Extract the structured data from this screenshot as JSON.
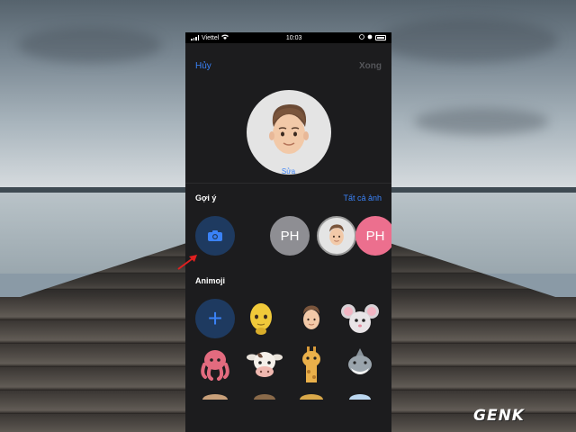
{
  "status_bar": {
    "carrier": "Viettel",
    "time": "10:03"
  },
  "nav": {
    "cancel_label": "Hủy",
    "done_label": "Xong"
  },
  "profile": {
    "edit_label": "Sửa"
  },
  "suggestions": {
    "title": "Gợi ý",
    "see_all_label": "Tất cả ảnh",
    "items": [
      {
        "type": "camera",
        "icon": "camera-icon"
      },
      {
        "type": "initials",
        "text": "PH",
        "color": "#8e8e93"
      },
      {
        "type": "memoji",
        "icon": "memoji-face"
      },
      {
        "type": "initials",
        "text": "PH",
        "color": "#ec6f8e"
      }
    ]
  },
  "animoji": {
    "title": "Animoji",
    "items": [
      {
        "icon": "plus-icon",
        "glyph": "+"
      },
      {
        "icon": "alien-icon"
      },
      {
        "icon": "memoji-face"
      },
      {
        "icon": "mouse-icon"
      },
      {
        "icon": "octopus-icon"
      },
      {
        "icon": "cow-icon"
      },
      {
        "icon": "giraffe-icon"
      },
      {
        "icon": "shark-icon"
      }
    ]
  },
  "watermark": {
    "brand": "GENK"
  },
  "colors": {
    "accent": "#3a82f7",
    "pink": "#ec6f8e",
    "dark_bg": "#1c1c1e"
  }
}
